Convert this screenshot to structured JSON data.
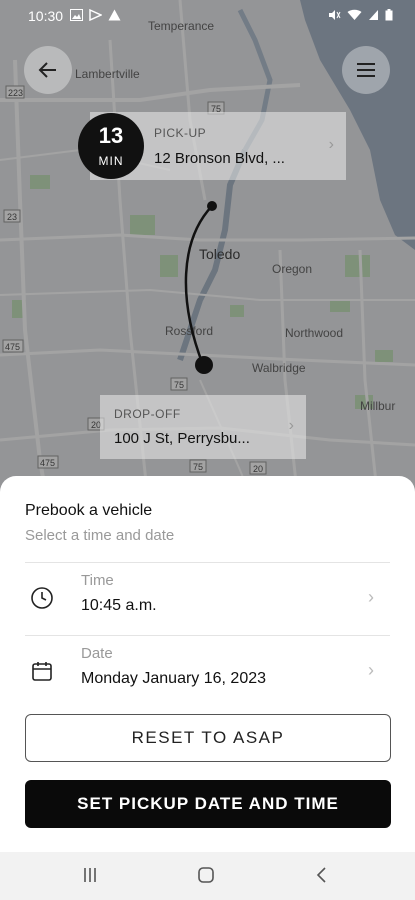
{
  "status_bar": {
    "time": "10:30"
  },
  "map": {
    "labels": [
      "Temperance",
      "Lambertville",
      "Toledo",
      "Oregon",
      "Rossford",
      "Northwood",
      "Walbridge",
      "Millbur"
    ],
    "road_numbers": [
      "223",
      "75",
      "23",
      "475",
      "75",
      "475",
      "20",
      "75",
      "20"
    ]
  },
  "eta": {
    "value": "13",
    "unit": "MIN"
  },
  "pickup": {
    "label": "PICK-UP",
    "address": "12 Bronson Blvd, ..."
  },
  "dropoff": {
    "label": "DROP-OFF",
    "address": "100 J St, Perrysbu..."
  },
  "sheet": {
    "title": "Prebook a vehicle",
    "subtitle": "Select a time and date",
    "time_row": {
      "label": "Time",
      "value": "10:45 a.m."
    },
    "date_row": {
      "label": "Date",
      "value": "Monday January 16, 2023"
    },
    "reset_button": "RESET TO ASAP",
    "set_button": "SET PICKUP DATE AND TIME"
  }
}
